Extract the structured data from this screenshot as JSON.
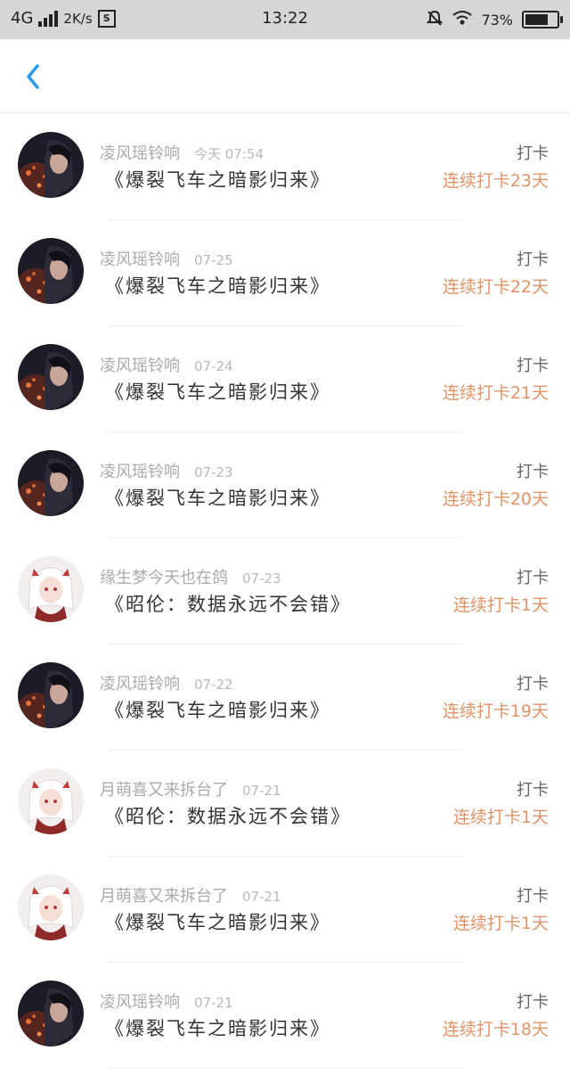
{
  "status_bar": {
    "network": "4G",
    "speed": "2K/s",
    "time": "13:22",
    "battery_percent": "73%",
    "battery_level": 0.73
  },
  "checkins": [
    {
      "user": "凌风瑶铃响",
      "time": "今天 07:54",
      "title": "《爆裂飞车之暗影归来》",
      "label": "打卡",
      "streak": "连续打卡23天",
      "avatar": "dark"
    },
    {
      "user": "凌风瑶铃响",
      "time": "07-25",
      "title": "《爆裂飞车之暗影归来》",
      "label": "打卡",
      "streak": "连续打卡22天",
      "avatar": "dark"
    },
    {
      "user": "凌风瑶铃响",
      "time": "07-24",
      "title": "《爆裂飞车之暗影归来》",
      "label": "打卡",
      "streak": "连续打卡21天",
      "avatar": "dark"
    },
    {
      "user": "凌风瑶铃响",
      "time": "07-23",
      "title": "《爆裂飞车之暗影归来》",
      "label": "打卡",
      "streak": "连续打卡20天",
      "avatar": "dark"
    },
    {
      "user": "缘生梦今天也在鸽",
      "time": "07-23",
      "title": "《昭伦：数据永远不会错》",
      "label": "打卡",
      "streak": "连续打卡1天",
      "avatar": "light"
    },
    {
      "user": "凌风瑶铃响",
      "time": "07-22",
      "title": "《爆裂飞车之暗影归来》",
      "label": "打卡",
      "streak": "连续打卡19天",
      "avatar": "dark"
    },
    {
      "user": "月萌喜又来拆台了",
      "time": "07-21",
      "title": "《昭伦：数据永远不会错》",
      "label": "打卡",
      "streak": "连续打卡1天",
      "avatar": "light"
    },
    {
      "user": "月萌喜又来拆台了",
      "time": "07-21",
      "title": "《爆裂飞车之暗影归来》",
      "label": "打卡",
      "streak": "连续打卡1天",
      "avatar": "light"
    },
    {
      "user": "凌风瑶铃响",
      "time": "07-21",
      "title": "《爆裂飞车之暗影归来》",
      "label": "打卡",
      "streak": "连续打卡18天",
      "avatar": "dark"
    }
  ]
}
